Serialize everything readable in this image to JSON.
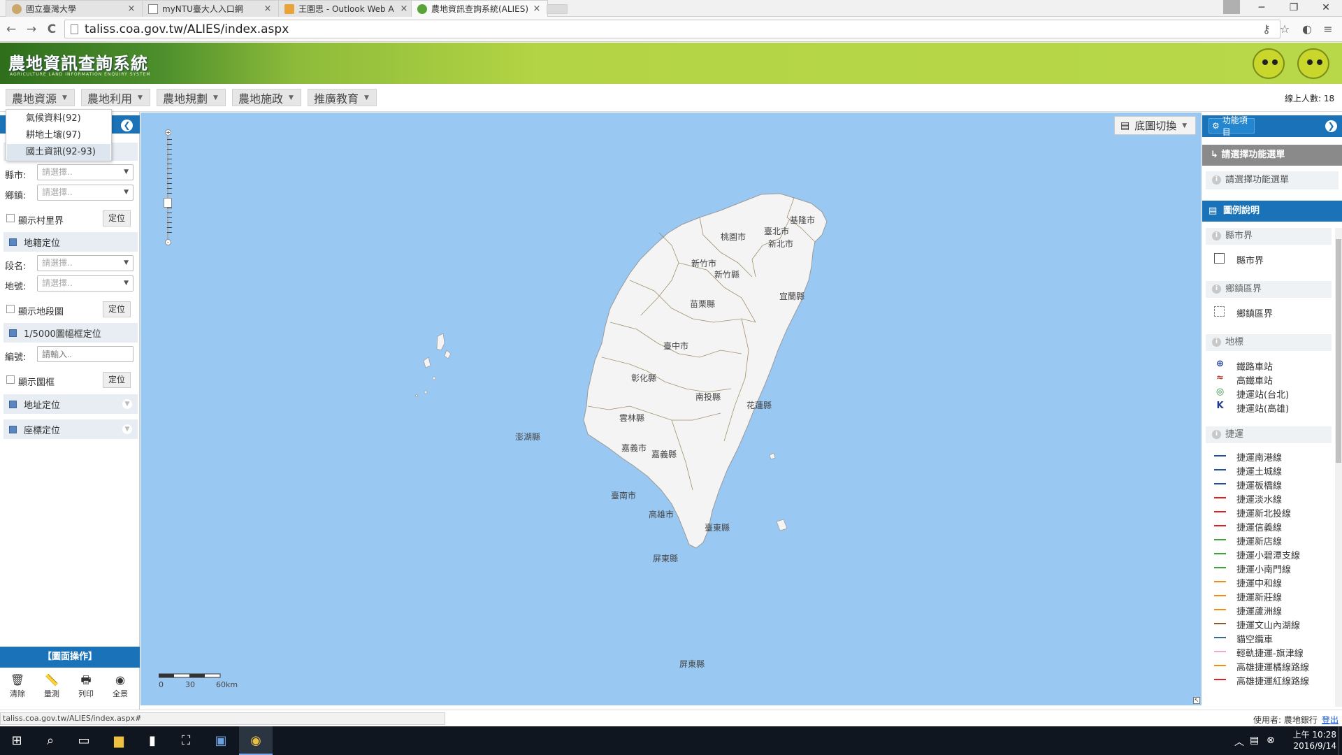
{
  "browser": {
    "tabs": [
      {
        "title": "國立臺灣大學",
        "icon": "ntu-seal-icon",
        "active": false
      },
      {
        "title": "myNTU臺大人入口網",
        "icon": "page-icon",
        "active": false
      },
      {
        "title": "王園思 - Outlook Web A",
        "icon": "outlook-icon",
        "active": false
      },
      {
        "title": "農地資訊查詢系統(ALIES)",
        "icon": "leaf-icon",
        "active": true
      }
    ],
    "tab_close": "×",
    "window_buttons": {
      "min": "─",
      "max": "❐",
      "close": "✕"
    },
    "nav": {
      "back": "←",
      "forward": "→",
      "reload": "C"
    },
    "url": "taliss.coa.gov.tw/ALIES/index.aspx",
    "right_icons": {
      "key": "⚷",
      "star": "☆",
      "ext": "◐",
      "menu": "≡"
    }
  },
  "banner": {
    "title": "農地資訊查詢系統",
    "subtitle": "AGRICULTURE LAND INFORMATION ENQUIRY SYSTEM"
  },
  "menubar": {
    "items": [
      "農地資源",
      "農地利用",
      "農地規劃",
      "農地施政",
      "推廣教育"
    ],
    "arrow": "▼",
    "online_label": "線上人數: 18"
  },
  "dropdown": {
    "items": [
      "氣候資料(92)",
      "耕地土壤(97)",
      "國土資訊(92-93)"
    ],
    "selected_index": 2
  },
  "left_panel": {
    "collapse_icon": "❮",
    "county_label": "縣市:",
    "town_label": "鄉鎮:",
    "select_placeholder": "請選擇..",
    "show_village": "顯示村里界",
    "locate_button": "定位",
    "cadastral_title": "地籍定位",
    "section_label": "段名:",
    "lot_label": "地號:",
    "show_cadastral": "顯示地段圖",
    "sheet_title": "1/5000圖幅框定位",
    "code_label": "編號:",
    "code_placeholder": "請輸入..",
    "show_frame": "顯示圖框",
    "address_title": "地址定位",
    "coord_title": "座標定位",
    "ops_title": "【圖面操作】",
    "ops": [
      {
        "label": "清除",
        "icon": "🗑"
      },
      {
        "label": "量測",
        "icon": "📏"
      },
      {
        "label": "列印",
        "icon": "🖶"
      },
      {
        "label": "全景",
        "icon": "◉"
      }
    ]
  },
  "map": {
    "basemap_button": "底圖切換",
    "scale_labels": [
      "0",
      "30",
      "60km"
    ],
    "counties": [
      "基隆市",
      "臺北市",
      "新北市",
      "桃園市",
      "新竹市",
      "新竹縣",
      "宜蘭縣",
      "苗栗縣",
      "臺中市",
      "彰化縣",
      "南投縣",
      "花蓮縣",
      "雲林縣",
      "澎湖縣",
      "嘉義市",
      "嘉義縣",
      "臺南市",
      "高雄市",
      "臺東縣",
      "屏東縣",
      "屏東縣"
    ]
  },
  "right_panel": {
    "function_button": "功能項目",
    "expand_icon": "❯",
    "choose_menu": "↳ 請選擇功能選單",
    "choose_menu_sub": "請選擇功能選單",
    "legend_title": "圖例說明",
    "legend": {
      "county_section": "縣市界",
      "county_item": "縣市界",
      "town_section": "鄉鎮區界",
      "town_item": "鄉鎮區界",
      "landmark_section": "地標",
      "landmarks": [
        {
          "label": "鐵路車站",
          "color": "#1f3a93"
        },
        {
          "label": "高鐵車站",
          "color": "#c0392b"
        },
        {
          "label": "捷運站(台北)",
          "color": "#2e8b3e"
        },
        {
          "label": "捷運站(高雄)",
          "color": "#1f3a93"
        }
      ],
      "metro_section": "捷運",
      "metro_lines": [
        {
          "label": "捷運南港線",
          "color": "#1f4fa0"
        },
        {
          "label": "捷運土城線",
          "color": "#1f4fa0"
        },
        {
          "label": "捷運板橋線",
          "color": "#1f4fa0"
        },
        {
          "label": "捷運淡水線",
          "color": "#e02020"
        },
        {
          "label": "捷運新北投線",
          "color": "#e02020"
        },
        {
          "label": "捷運信義線",
          "color": "#e02020"
        },
        {
          "label": "捷運新店線",
          "color": "#3aa63a"
        },
        {
          "label": "捷運小碧潭支線",
          "color": "#3aa63a"
        },
        {
          "label": "捷運小南門線",
          "color": "#3aa63a"
        },
        {
          "label": "捷運中和線",
          "color": "#f08a1a"
        },
        {
          "label": "捷運新莊線",
          "color": "#f08a1a"
        },
        {
          "label": "捷運蘆洲線",
          "color": "#f08a1a"
        },
        {
          "label": "捷運文山內湖線",
          "color": "#8b5a2b"
        },
        {
          "label": "貓空纜車",
          "color": "#3a6a8a"
        },
        {
          "label": "輕軌捷運-旗津線",
          "color": "#f0a8d0"
        },
        {
          "label": "高雄捷運橘線路線",
          "color": "#f08a1a"
        },
        {
          "label": "高雄捷運紅線路線",
          "color": "#e02020"
        }
      ]
    }
  },
  "status": {
    "url": "taliss.coa.gov.tw/ALIES/index.aspx#",
    "user": "使用者: 農地銀行",
    "logout": "登出"
  },
  "taskbar": {
    "time": "上午 10:28",
    "date": "2016/9/14"
  }
}
